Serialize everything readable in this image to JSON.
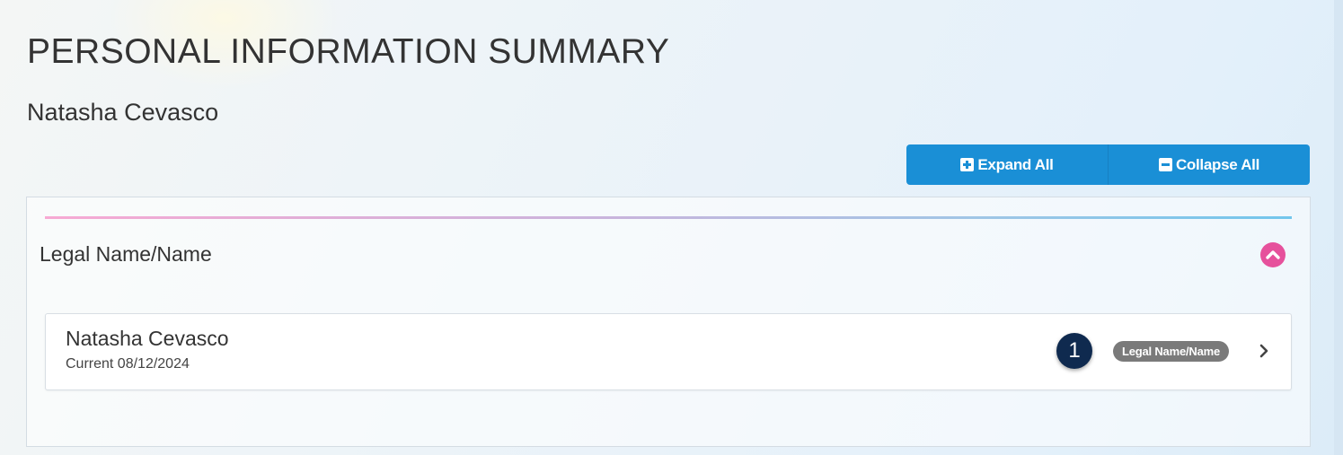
{
  "header": {
    "title": "PERSONAL INFORMATION SUMMARY",
    "person_name": "Natasha Cevasco"
  },
  "toolbar": {
    "expand_label": "Expand All",
    "collapse_label": "Collapse All",
    "expand_icon": "plus-square-icon",
    "collapse_icon": "minus-square-icon",
    "button_color": "#1a8fd6"
  },
  "section": {
    "title": "Legal Name/Name",
    "toggle_icon": "chevron-up-circle-icon",
    "toggle_color": "#e6519c",
    "records": [
      {
        "name": "Natasha Cevasco",
        "status": "Current 08/12/2024",
        "badge_count": "1",
        "tag": "Legal Name/Name",
        "action_icon": "chevron-right-icon"
      }
    ]
  },
  "colors": {
    "badge": "#0f2a4f",
    "tag": "#7a7a7a",
    "accent_start": "#f7a9d3",
    "accent_end": "#72c6ec"
  }
}
